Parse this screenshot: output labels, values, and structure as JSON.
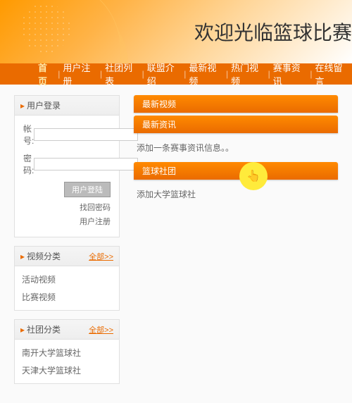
{
  "header": {
    "title": "欢迎光临篮球比赛"
  },
  "nav": {
    "items": [
      "首页",
      "用户注册",
      "社团列表",
      "联盟介绍",
      "最新视频",
      "热门视频",
      "赛事资讯",
      "在线留言"
    ],
    "active": 0
  },
  "login_panel": {
    "title": "用户登录",
    "account_label": "帐号:",
    "password_label": "密码:",
    "login_btn": "用户登陆",
    "forgot": "找回密码",
    "register": "用户注册"
  },
  "video_cat": {
    "title": "视频分类",
    "more": "全部>>",
    "items": [
      "活动视频",
      "比赛视频"
    ]
  },
  "club_cat": {
    "title": "社团分类",
    "more": "全部>>",
    "items": [
      "南开大学篮球社",
      "天津大学篮球社"
    ]
  },
  "content": {
    "tab1": "最新视频",
    "tab2": "最新资讯",
    "text1": "添加一条赛事资讯信息。。",
    "tab3": "篮球社团",
    "text2": "添加大学篮球社"
  },
  "cursor_icon": "👆"
}
